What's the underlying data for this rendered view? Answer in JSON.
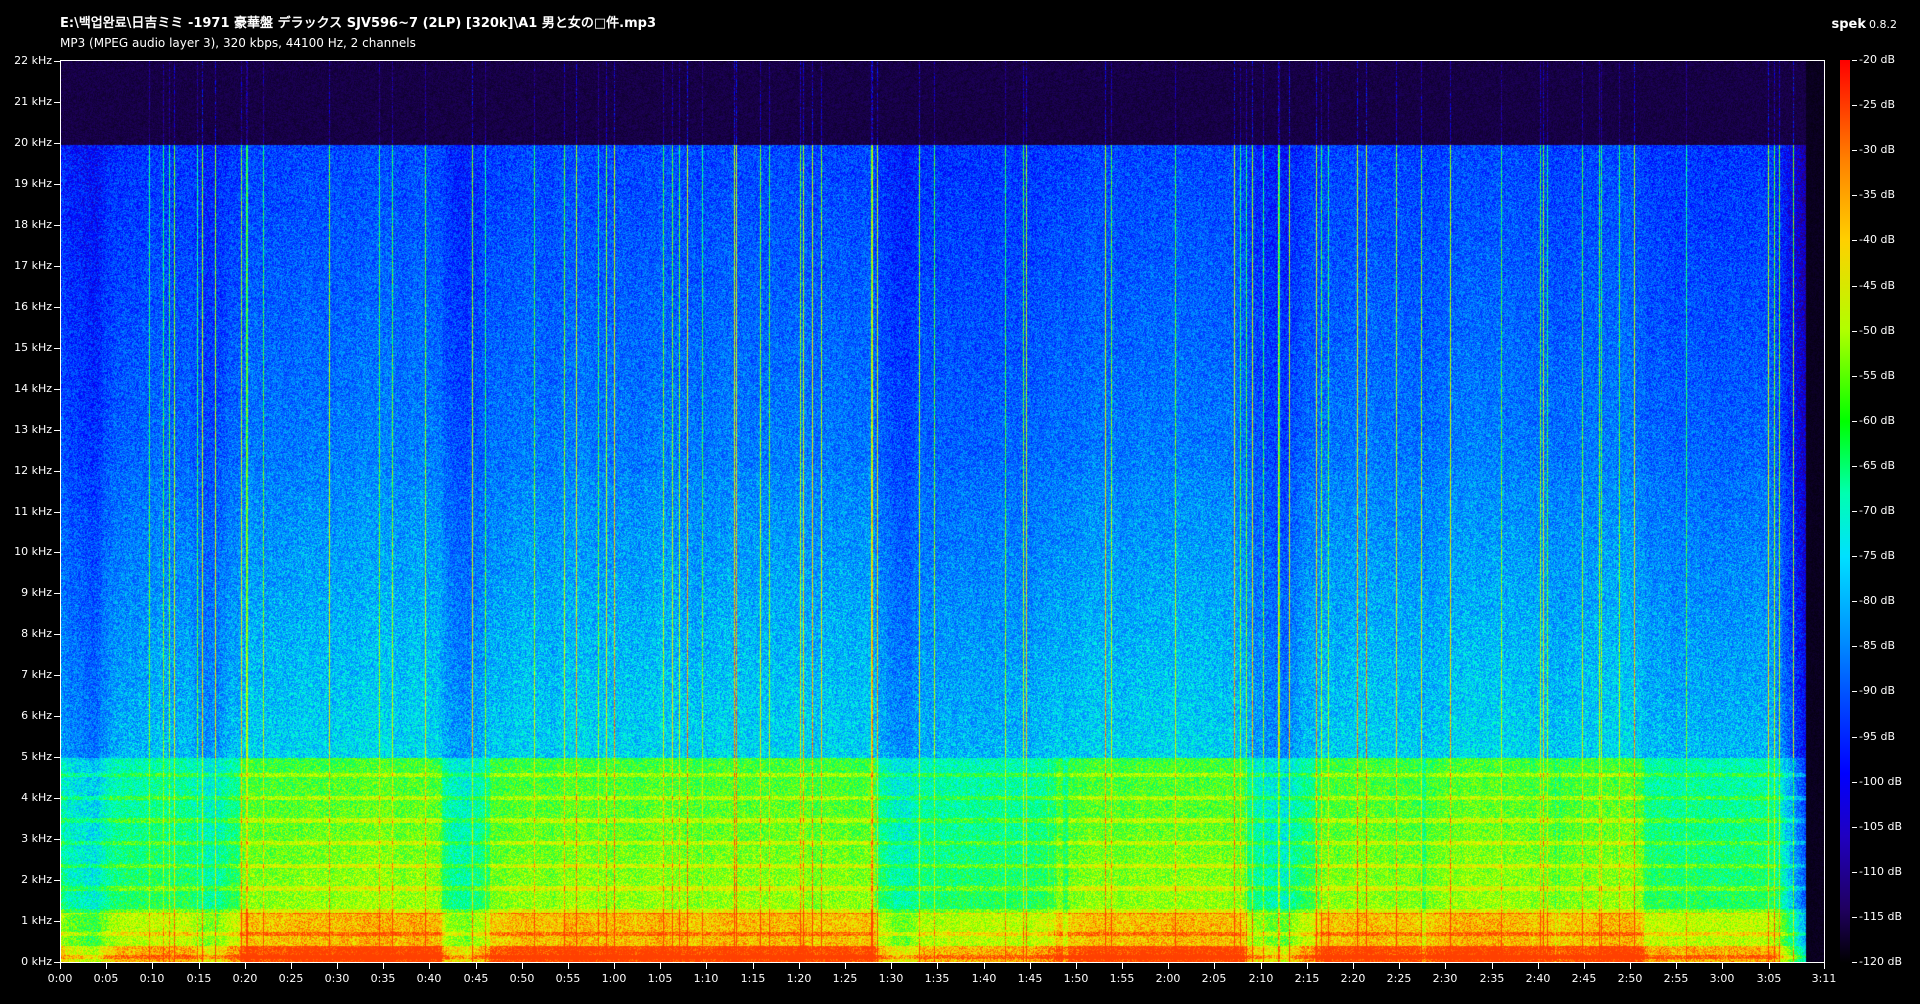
{
  "window": {
    "file_path": "E:\\백업완료\\日吉ミミ -1971 豪華盤 デラックス SJV596~7 (2LP) [320k]\\A1 男と女の□件.mp3",
    "file_info": "MP3 (MPEG audio layer 3), 320 kbps, 44100 Hz, 2 channels",
    "app_name": "spek",
    "app_version": "0.8.2"
  },
  "frequency_axis": {
    "labels": [
      "22 kHz",
      "21 kHz",
      "20 kHz",
      "19 kHz",
      "18 kHz",
      "17 kHz",
      "16 kHz",
      "15 kHz",
      "14 kHz",
      "13 kHz",
      "12 kHz",
      "11 kHz",
      "10 kHz",
      "9 kHz",
      "8 kHz",
      "7 kHz",
      "6 kHz",
      "5 kHz",
      "4 kHz",
      "3 kHz",
      "2 kHz",
      "1 kHz",
      "0 kHz"
    ],
    "range_khz": [
      0,
      22.05
    ]
  },
  "time_axis": {
    "labels": [
      "0:00",
      "0:05",
      "0:10",
      "0:15",
      "0:20",
      "0:25",
      "0:30",
      "0:35",
      "0:40",
      "0:45",
      "0:50",
      "0:55",
      "1:00",
      "1:05",
      "1:10",
      "1:15",
      "1:20",
      "1:25",
      "1:30",
      "1:35",
      "1:40",
      "1:45",
      "1:50",
      "1:55",
      "2:00",
      "2:05",
      "2:10",
      "2:15",
      "2:20",
      "2:25",
      "2:30",
      "2:35",
      "2:40",
      "2:45",
      "2:50",
      "2:55",
      "3:00",
      "3:05",
      "3:11"
    ],
    "duration_seconds": 191
  },
  "colorbar": {
    "labels": [
      "-20 dB",
      "-25 dB",
      "-30 dB",
      "-35 dB",
      "-40 dB",
      "-45 dB",
      "-50 dB",
      "-55 dB",
      "-60 dB",
      "-65 dB",
      "-70 dB",
      "-75 dB",
      "-80 dB",
      "-85 dB",
      "-90 dB",
      "-95 dB",
      "-100 dB",
      "-105 dB",
      "-110 dB",
      "-115 dB",
      "-120 dB"
    ],
    "range_db": [
      -120,
      -20
    ]
  },
  "spectrum": {
    "lowpass_cutoff_khz": 20,
    "music_end_seconds": 185.5,
    "intensity_colors": [
      "#000000",
      "#1a0050",
      "#2a0090",
      "#0000ff",
      "#0050ff",
      "#00a0ff",
      "#00ffe0",
      "#00ff60",
      "#7fff00",
      "#e0ff00",
      "#ffb000",
      "#ff4000"
    ]
  }
}
